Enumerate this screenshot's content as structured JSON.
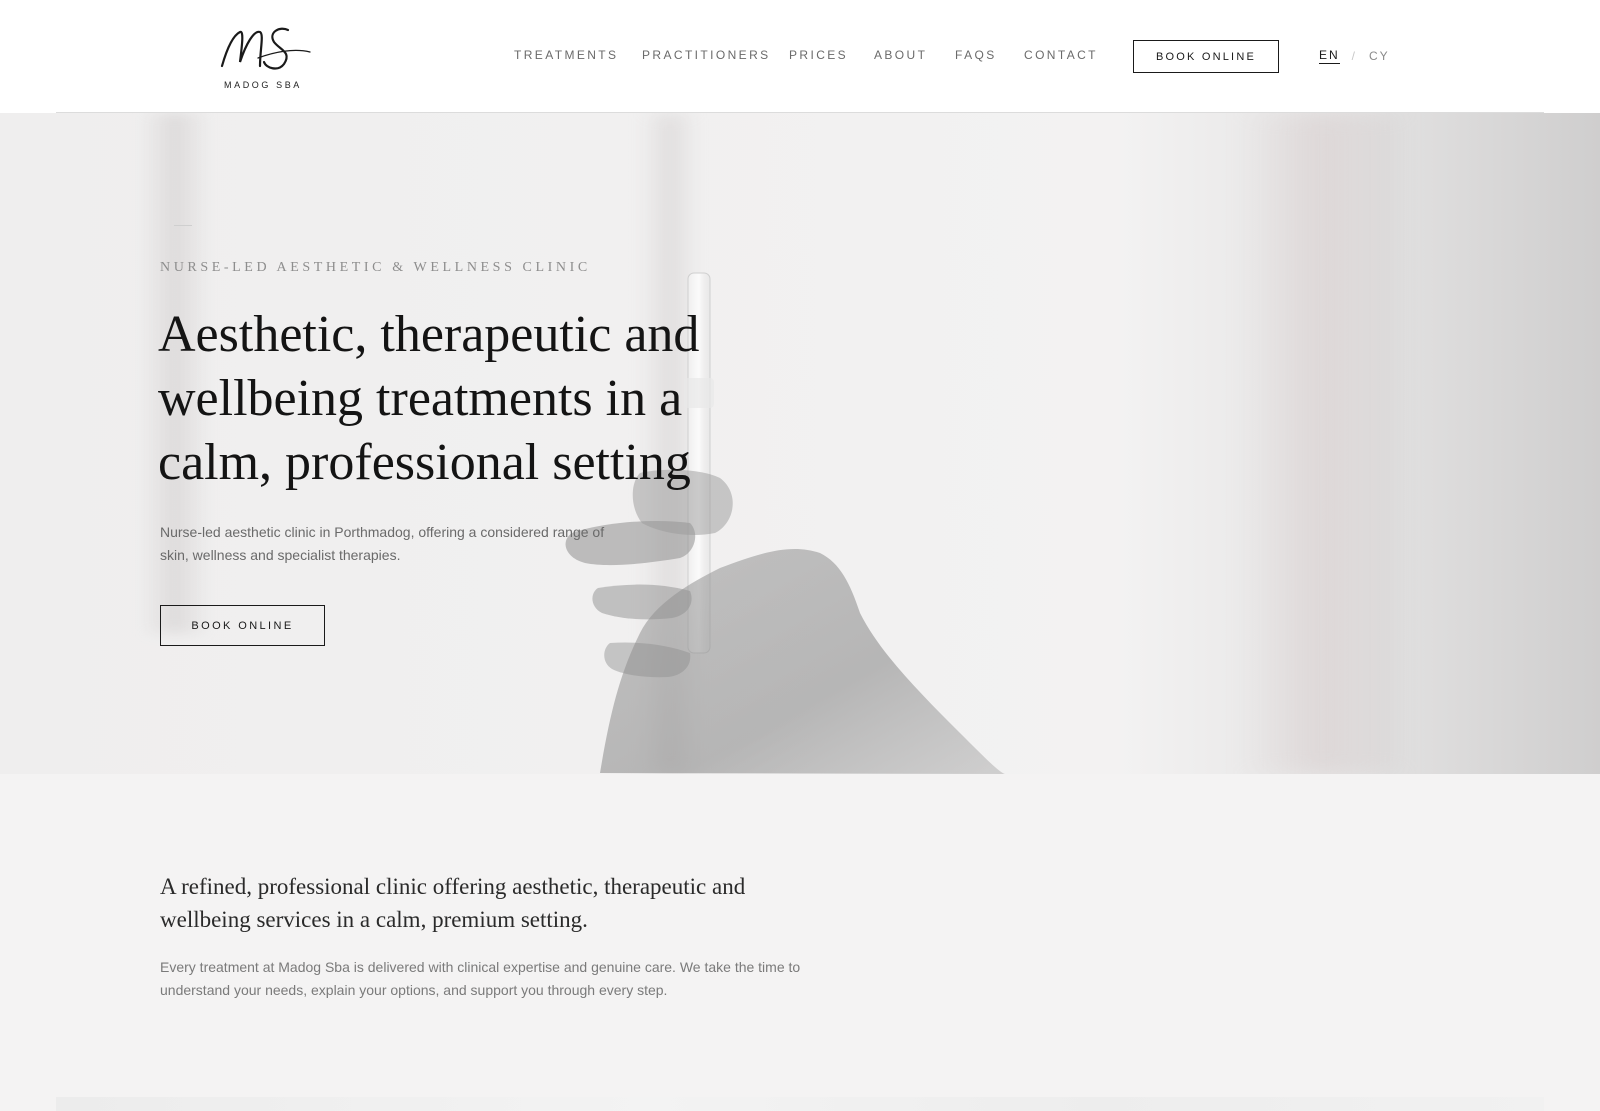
{
  "brand": {
    "monogram": "MS",
    "name": "MADOG SBA"
  },
  "nav": {
    "items": [
      "TREATMENTS",
      "PRACTITIONERS",
      "PRICES",
      "ABOUT",
      "FAQS",
      "CONTACT"
    ],
    "book_label": "BOOK ONLINE"
  },
  "language": {
    "active": "EN",
    "separator": "/",
    "other": "CY"
  },
  "hero": {
    "eyebrow": "NURSE-LED AESTHETIC & WELLNESS CLINIC",
    "title": "Aesthetic, therapeutic and wellbeing treatments in a calm, professional setting",
    "subtitle": "Nurse-led aesthetic clinic in Porthmadog, offering a considered range of skin, wellness and specialist therapies.",
    "cta_label": "BOOK ONLINE"
  },
  "intro": {
    "lead": "A refined, professional clinic offering aesthetic, therapeutic and wellbeing services in a calm, premium setting.",
    "body": "Every treatment at Madog Sba is delivered with clinical expertise and genuine care. We take the time to understand your needs, explain your options, and support you through every step."
  },
  "colors": {
    "text": "#141414",
    "muted": "#6a6a6a",
    "background": "#f4f3f3",
    "header": "#ffffff"
  }
}
